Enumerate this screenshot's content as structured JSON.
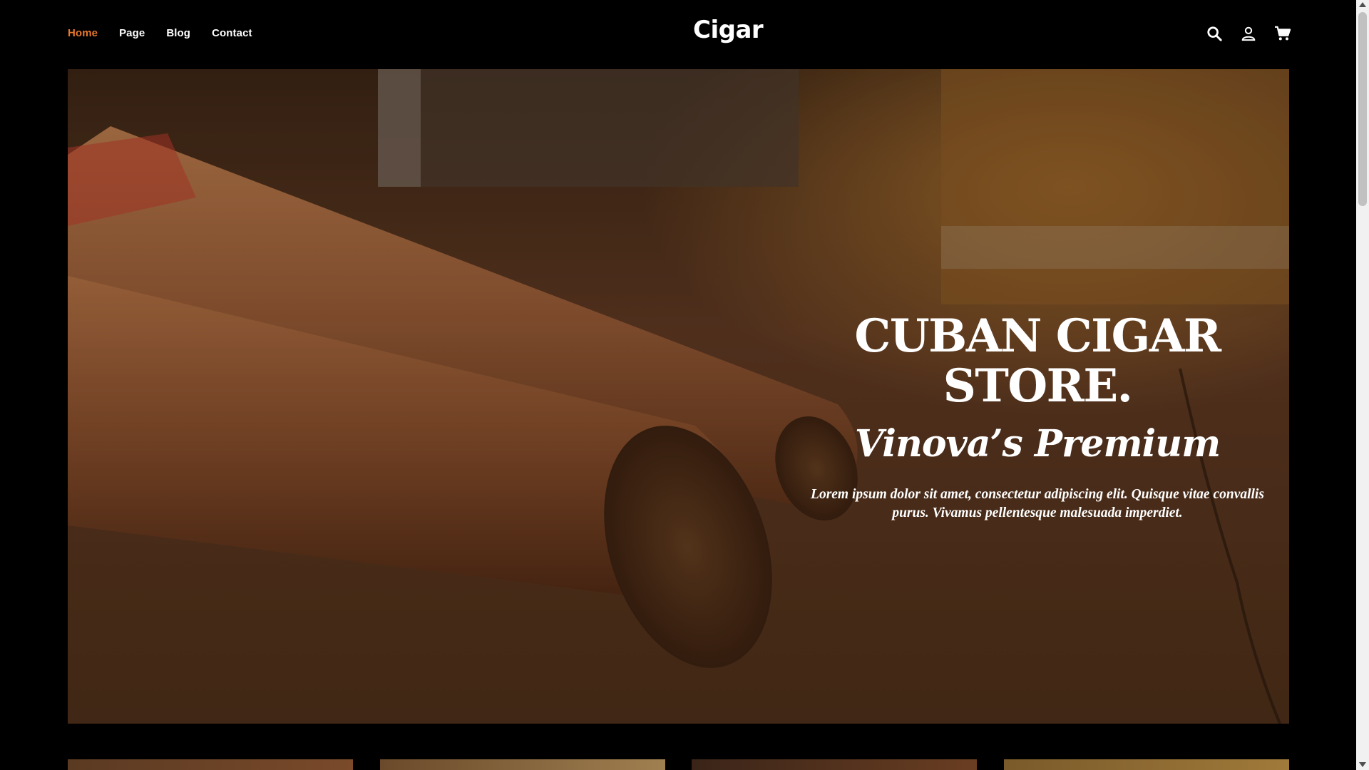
{
  "header": {
    "logo": "Cigar",
    "nav": [
      {
        "label": "Home",
        "active": true
      },
      {
        "label": "Page",
        "active": false
      },
      {
        "label": "Blog",
        "active": false
      },
      {
        "label": "Contact",
        "active": false
      }
    ],
    "icons": [
      "search-icon",
      "user-icon",
      "cart-icon"
    ]
  },
  "hero": {
    "title": "CUBAN CIGAR STORE.",
    "subtitle": "Vinova’s Premium",
    "body": "Lorem ipsum dolor sit amet, consectetur adipiscing elit. Quisque vitae convallis purus. Vivamus pellentesque malesuada imperdiet."
  },
  "colors": {
    "accent": "#e8772e",
    "background": "#000000",
    "text": "#ffffff"
  }
}
